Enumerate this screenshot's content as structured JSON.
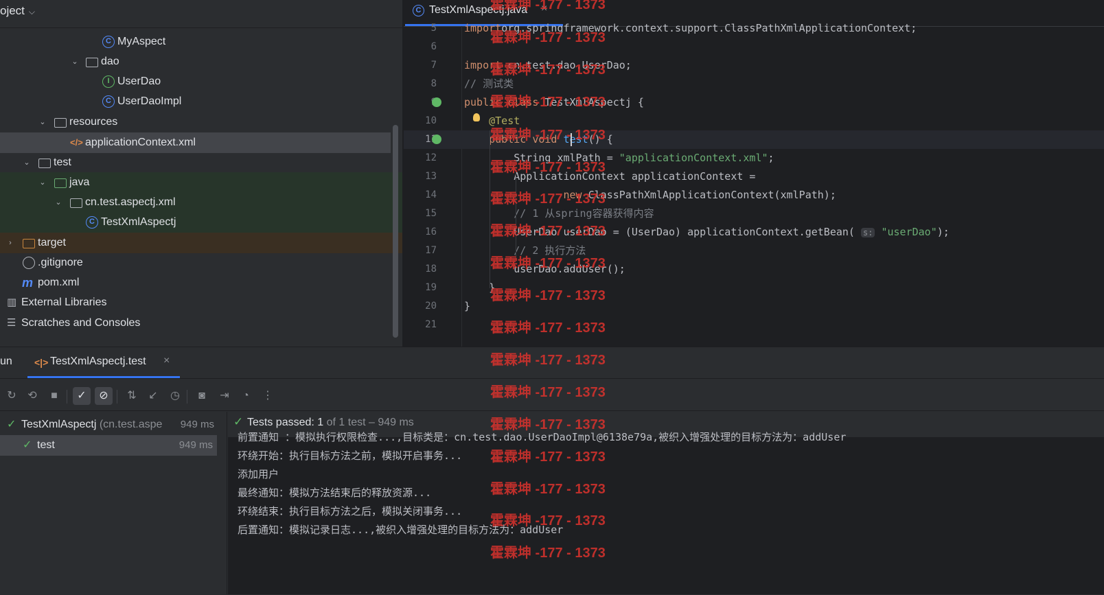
{
  "project": {
    "title": "oject",
    "tree": [
      {
        "label": "MyAspect",
        "icon": "class-icon"
      },
      {
        "label": "dao",
        "icon": "folder-icon"
      },
      {
        "label": "UserDao",
        "icon": "interface-icon"
      },
      {
        "label": "UserDaoImpl",
        "icon": "class-icon"
      },
      {
        "label": "resources",
        "icon": "folder-icon"
      },
      {
        "label": "applicationContext.xml",
        "icon": "xml-file-icon"
      },
      {
        "label": "test",
        "icon": "folder-icon"
      },
      {
        "label": "java",
        "icon": "folder-icon"
      },
      {
        "label": "cn.test.aspectj.xml",
        "icon": "package-icon"
      },
      {
        "label": "TestXmlAspectj",
        "icon": "class-icon"
      },
      {
        "label": "target",
        "icon": "folder-icon"
      },
      {
        "label": ".gitignore",
        "icon": "gitignore-icon"
      },
      {
        "label": "pom.xml",
        "icon": "maven-icon"
      },
      {
        "label": "External Libraries",
        "icon": "library-icon"
      },
      {
        "label": "Scratches and Consoles",
        "icon": "scratches-icon"
      }
    ]
  },
  "editor": {
    "tab": "TestXmlAspectj.java",
    "tab_close": "×",
    "lines": [
      {
        "n": "5",
        "parts": [
          [
            "kw",
            "import"
          ],
          [
            "",
            "org.springframework.context.support.ClassPathXmlApplicationContext;"
          ]
        ]
      },
      {
        "n": "6",
        "parts": []
      },
      {
        "n": "7",
        "parts": [
          [
            "kw",
            "import"
          ],
          [
            "",
            " cn.test.dao.UserDao;"
          ]
        ]
      },
      {
        "n": "8",
        "parts": [
          [
            "cmt",
            "// 测试类"
          ]
        ]
      },
      {
        "n": "9",
        "parts": [
          [
            "kw",
            "public class"
          ],
          [
            "",
            " TestXmlAspectj {"
          ]
        ]
      },
      {
        "n": "10",
        "parts": [
          [
            "",
            "    "
          ],
          [
            "ann",
            "@Test"
          ]
        ]
      },
      {
        "n": "11",
        "parts": [
          [
            "",
            "    "
          ],
          [
            "kw",
            "public void"
          ],
          [
            "",
            " "
          ],
          [
            "fn",
            "test"
          ],
          [
            "",
            "() {"
          ]
        ]
      },
      {
        "n": "12",
        "parts": [
          [
            "",
            "        String xmlPath = "
          ],
          [
            "str",
            "\"applicationContext.xml\""
          ],
          [
            "",
            ";"
          ]
        ]
      },
      {
        "n": "13",
        "parts": [
          [
            "",
            "        ApplicationContext applicationContext ="
          ]
        ]
      },
      {
        "n": "14",
        "parts": [
          [
            "",
            "                "
          ],
          [
            "kw",
            "new"
          ],
          [
            "",
            " ClassPathXmlApplicationContext(xmlPath);"
          ]
        ]
      },
      {
        "n": "15",
        "parts": [
          [
            "",
            "        "
          ],
          [
            "cmt",
            "// 1 从spring容器获得内容"
          ]
        ]
      },
      {
        "n": "16",
        "parts": [
          [
            "",
            "        UserDao userDao = (UserDao) applicationContext.getBean( "
          ],
          [
            "hint",
            "s:"
          ],
          [
            "",
            " "
          ],
          [
            "str",
            "\"userDao\""
          ],
          [
            "",
            ");"
          ]
        ]
      },
      {
        "n": "17",
        "parts": [
          [
            "",
            "        "
          ],
          [
            "cmt",
            "// 2 执行方法"
          ]
        ]
      },
      {
        "n": "18",
        "parts": [
          [
            "",
            "        userDao.addUser();"
          ]
        ]
      },
      {
        "n": "19",
        "parts": [
          [
            "",
            "    }"
          ]
        ]
      },
      {
        "n": "20",
        "parts": [
          [
            "",
            "}"
          ]
        ]
      },
      {
        "n": "21",
        "parts": []
      }
    ]
  },
  "run": {
    "label": "un",
    "tab": "TestXmlAspectj.test",
    "tab_close": "×",
    "toolbar_icons": [
      "rerun-icon",
      "rerun-failed-icon",
      "stop-icon",
      "show-passed-icon",
      "show-ignored-icon",
      "sort-icon",
      "collapse-icon",
      "history-icon",
      "camera-icon",
      "import-icon",
      "coverage-icon",
      "more-icon"
    ],
    "tests": [
      {
        "name": "TestXmlAspectj",
        "pkg": "(cn.test.aspe",
        "dur": "949 ms"
      },
      {
        "name": "test",
        "pkg": "",
        "dur": "949 ms"
      }
    ],
    "status": {
      "passed": "Tests passed: 1",
      "rest": " of 1 test – 949 ms"
    },
    "console": [
      "前置通知 ：模拟执行权限检查...,目标类是：cn.test.dao.UserDaoImpl@6138e79a,被织入增强处理的目标方法为：addUser",
      "环绕开始：执行目标方法之前，模拟开启事务...",
      "添加用户",
      "最终通知：模拟方法结束后的释放资源...",
      "环绕结束：执行目标方法之后，模拟关闭事务...",
      "后置通知：模拟记录日志...,被织入增强处理的目标方法为：addUser"
    ]
  },
  "watermark": "霍霖坤 -177 - 1373"
}
